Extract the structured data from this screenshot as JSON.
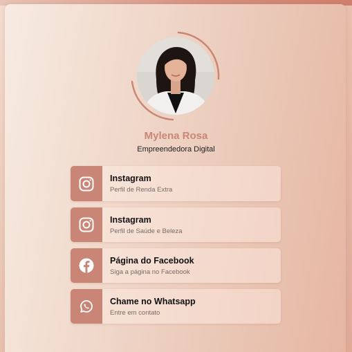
{
  "profile": {
    "name": "Mylena Rosa",
    "subtitle": "Empreendedora Digital"
  },
  "links": [
    {
      "title": "Instagram",
      "description": "Perfil de Renda Extra",
      "icon": "instagram-icon"
    },
    {
      "title": "Instagram",
      "description": "Perfil de Saúde e Beleza",
      "icon": "instagram-icon"
    },
    {
      "title": "Página do Facebook",
      "description": "Siga a página no Facebook",
      "icon": "facebook-icon"
    },
    {
      "title": "Chame no Whatsapp",
      "description": "Entre em contato",
      "icon": "whatsapp-icon"
    }
  ],
  "colors": {
    "accent": "#c98676",
    "name": "#c98775",
    "text": "#111111",
    "muted": "#7a6a64"
  }
}
